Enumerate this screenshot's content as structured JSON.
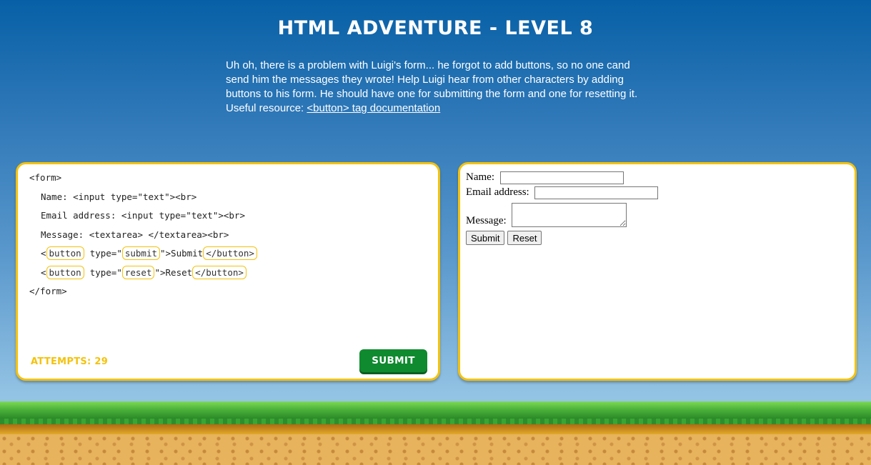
{
  "header": {
    "title": "HTML ADVENTURE - LEVEL 8",
    "intro_text": "Uh oh, there is a problem with Luigi's form... he forgot to add buttons, so no one cand send him the messages they wrote! Help Luigi hear from other characters by adding buttons to his form. He should have one for submitting the form and one for resetting it.",
    "resource_prefix": "Useful resource: ",
    "resource_link": "<button> tag documentation"
  },
  "editor": {
    "lines": {
      "form_open": "<form>",
      "name_line": "Name: <input type=\"text\"><br>",
      "email_line": "Email address: <input type=\"text\"><br>",
      "message_line": "Message: <textarea> </textarea><br>",
      "lt": "<",
      "type_open": "type=\"",
      "submit_rest": "\">Submit",
      "reset_rest": "\">Reset",
      "form_close": "</form>"
    },
    "answers": {
      "button_tag_1": "button",
      "type_value_1": "submit",
      "close_tag_1": "</button>",
      "button_tag_2": "button",
      "type_value_2": "reset",
      "close_tag_2": "</button>"
    },
    "attempts_label": "ATTEMPTS: 29",
    "submit_label": "SUBMIT"
  },
  "preview": {
    "name_label": "Name: ",
    "email_label": "Email address: ",
    "message_label": "Message: ",
    "submit_button": "Submit",
    "reset_button": "Reset"
  },
  "colors": {
    "accent": "#f4c20d",
    "submit_green": "#0f8a2f",
    "sky_top": "#0760a6",
    "sky_bottom": "#a9d3ee"
  }
}
